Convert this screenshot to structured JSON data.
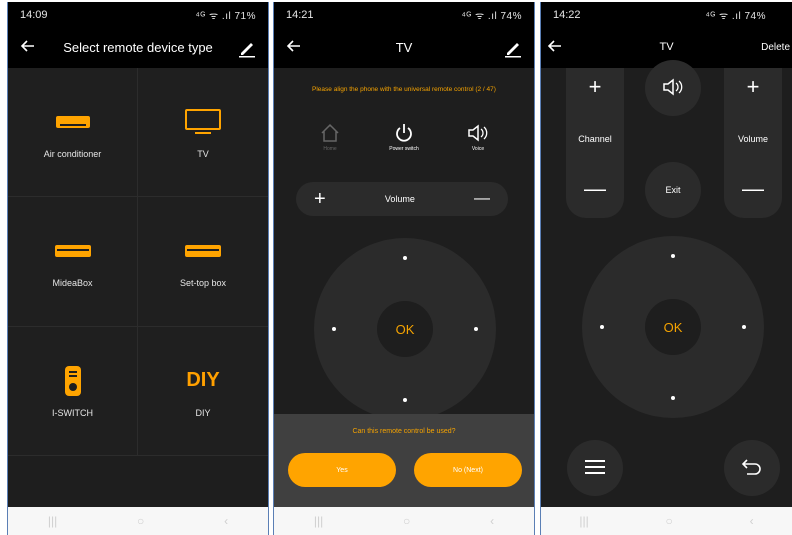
{
  "screen1": {
    "status": {
      "time": "14:09",
      "right": "⁴ᴳ ᯤ .ıl 71%"
    },
    "title": "Select remote device type",
    "devices": [
      {
        "label": "Air conditioner",
        "icon": "air-conditioner-icon"
      },
      {
        "label": "TV",
        "icon": "tv-icon"
      },
      {
        "label": "MideaBox",
        "icon": "midea-box-icon"
      },
      {
        "label": "Set-top box",
        "icon": "set-top-box-icon"
      },
      {
        "label": "I-SWITCH",
        "icon": "remote-icon"
      },
      {
        "label": "DIY",
        "icon_text": "DIY"
      }
    ]
  },
  "screen2": {
    "status": {
      "time": "14:21",
      "right": "⁴ᴳ ᯤ .ıl 74%"
    },
    "title": "TV",
    "prompt": "Please align the phone with the universal remote control (2 / 47)",
    "top_buttons": [
      {
        "label": "Home",
        "icon": "home-icon"
      },
      {
        "label": "Power switch",
        "icon": "power-icon"
      },
      {
        "label": "Voice",
        "icon": "speaker-icon"
      }
    ],
    "volume": {
      "plus": "+",
      "label": "Volume",
      "minus": "—"
    },
    "ok": "OK",
    "question": "Can this remote control be used?",
    "yes": "Yes",
    "no": "No (Next)"
  },
  "screen3": {
    "status": {
      "time": "14:22",
      "right": "⁴ᴳ ᯤ .ıl 74%"
    },
    "title": "TV",
    "delete": "Delete",
    "channel": {
      "plus": "+",
      "label": "Channel",
      "minus": "—"
    },
    "volume": {
      "plus": "+",
      "label": "Volume",
      "minus": "—"
    },
    "exit": "Exit",
    "ok": "OK"
  },
  "colors": {
    "accent": "#ffa400",
    "bg": "#1e1e1e",
    "panel": "#2b2b2b"
  }
}
